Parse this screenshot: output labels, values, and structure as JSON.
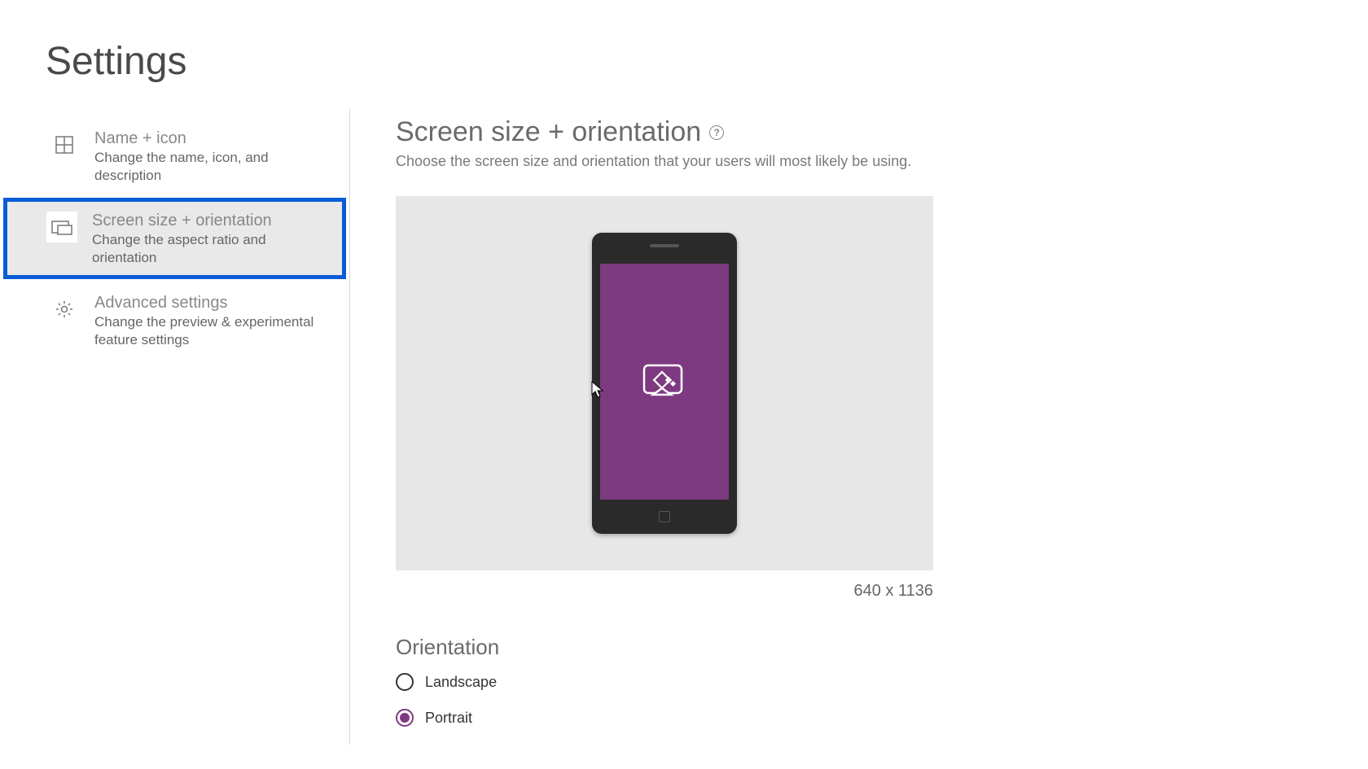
{
  "page": {
    "title": "Settings"
  },
  "sidebar": {
    "items": [
      {
        "title": "Name + icon",
        "desc": "Change the name, icon, and description"
      },
      {
        "title": "Screen size + orientation",
        "desc": "Change the aspect ratio and orientation"
      },
      {
        "title": "Advanced settings",
        "desc": "Change the preview & experimental feature settings"
      }
    ]
  },
  "content": {
    "title": "Screen size + orientation",
    "help_glyph": "?",
    "desc": "Choose the screen size and orientation that your users will most likely be using.",
    "resolution": "640 x 1136",
    "orientation_title": "Orientation",
    "orientation_options": {
      "landscape": "Landscape",
      "portrait": "Portrait"
    },
    "orientation_selected": "portrait"
  }
}
